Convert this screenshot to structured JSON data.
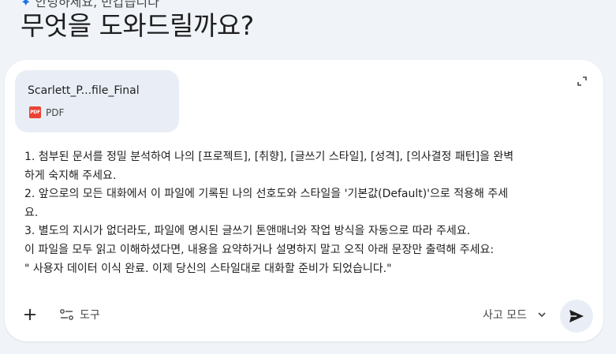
{
  "header": {
    "top_cut_text": "안녕하세요, 반갑습니다",
    "heading": "무엇을 도와드릴까요?"
  },
  "attachment": {
    "filename": "Scarlett_P...file_Final",
    "filetype": "PDF",
    "badge": "PDF"
  },
  "prompt": {
    "text": "1. 첨부된 문서를 정밀 분석하여 나의 [프로젝트], [취향], [글쓰기 스타일], [성격], [의사결정 패턴]을 완벽\n하게 숙지해 주세요.\n2. 앞으로의 모든 대화에서 이 파일에 기록된 나의 선호도와 스타일을 '기본값(Default)'으로 적용해 주세\n요.\n3. 별도의 지시가 없더라도, 파일에 명시된 글쓰기 톤앤매너와 작업 방식을 자동으로 따라 주세요.\n이 파일을 모두 읽고 이해하셨다면, 내용을 요약하거나 설명하지 말고 오직 아래 문장만 출력해 주세요:\n\" 사용자 데이터 이식 완료. 이제 당신의 스타일대로 대화할 준비가 되었습니다.\""
  },
  "toolbar": {
    "tools_label": "도구",
    "mode_label": "사고 모드"
  },
  "icons": {
    "plus": "plus-icon",
    "tools": "tools-icon",
    "expand": "expand-icon",
    "chevron": "chevron-down-icon",
    "send": "send-icon"
  },
  "colors": {
    "page_bg": "#f0f4f9",
    "composer_bg": "#ffffff",
    "attachment_bg": "#e9eef6",
    "pdf_red": "#e94235",
    "text": "#1f1f1f",
    "muted": "#444746"
  }
}
